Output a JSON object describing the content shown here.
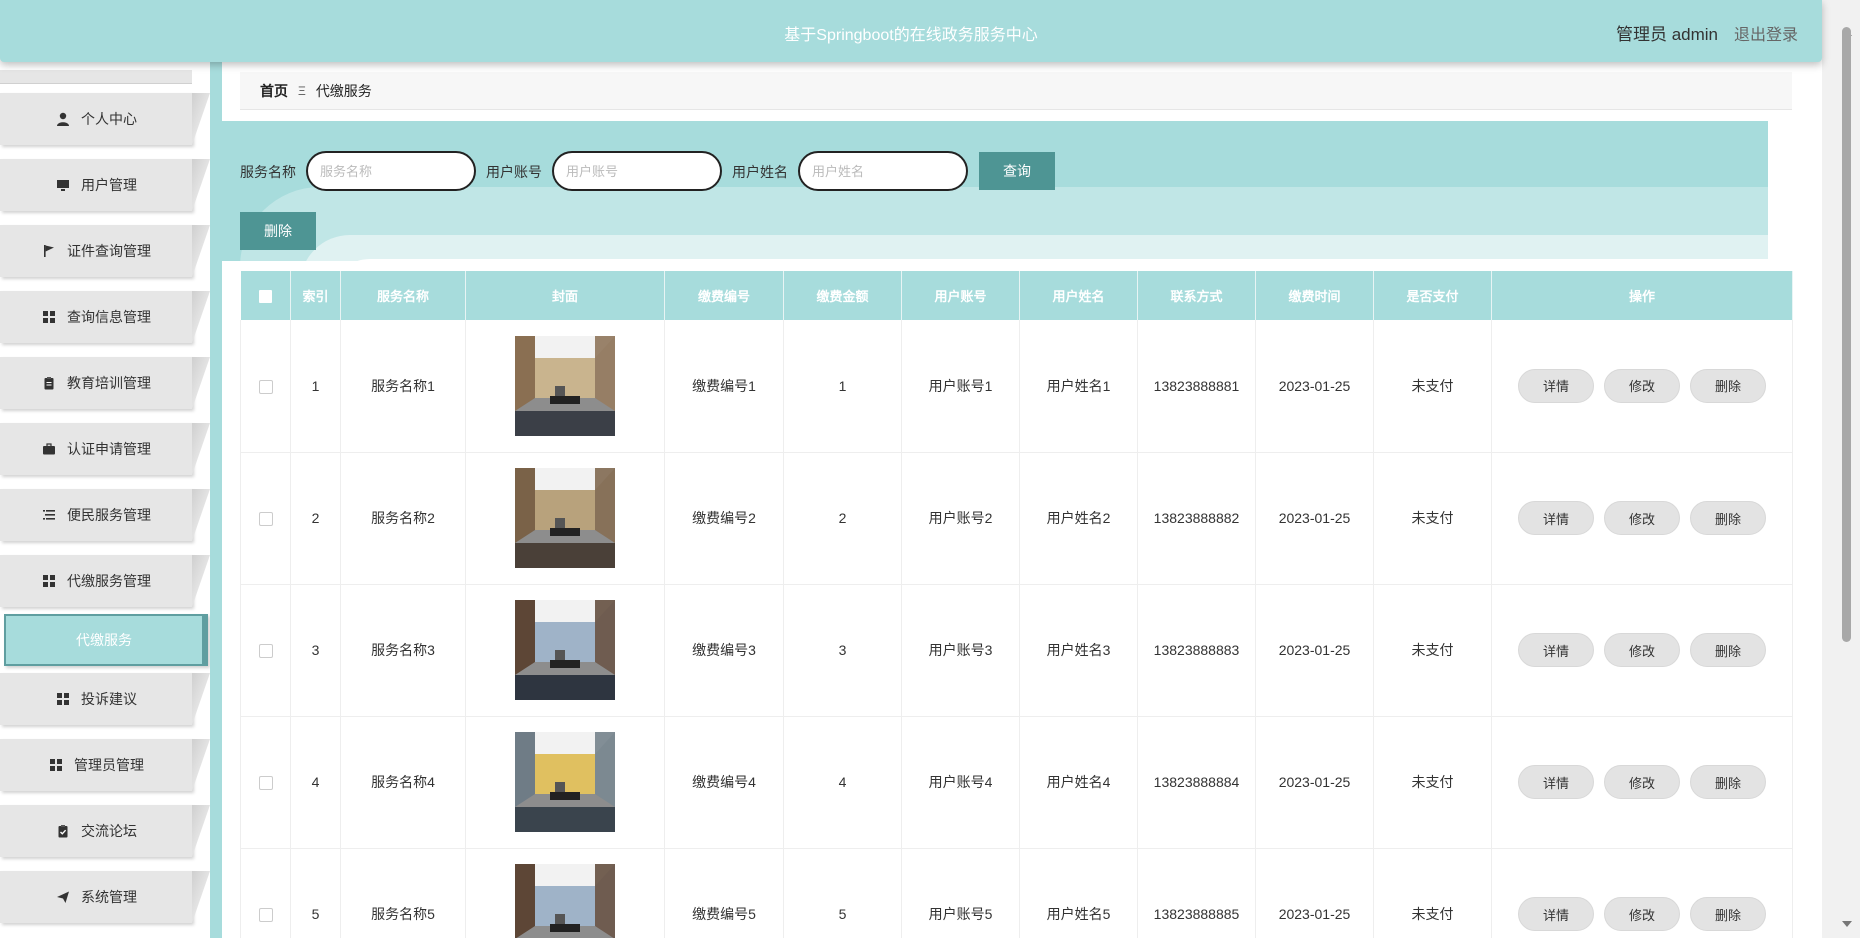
{
  "header": {
    "title": "基于Springboot的在线政务服务中心",
    "user_label": "管理员 admin",
    "logout_label": "退出登录"
  },
  "sidebar": {
    "items": [
      {
        "label": "个人中心",
        "icon": "user-icon"
      },
      {
        "label": "用户管理",
        "icon": "monitor-icon"
      },
      {
        "label": "证件查询管理",
        "icon": "flag-icon"
      },
      {
        "label": "查询信息管理",
        "icon": "grid-icon"
      },
      {
        "label": "教育培训管理",
        "icon": "clipboard-icon"
      },
      {
        "label": "认证申请管理",
        "icon": "briefcase-icon"
      },
      {
        "label": "便民服务管理",
        "icon": "list-icon"
      },
      {
        "label": "代缴服务管理",
        "icon": "grid-icon"
      },
      {
        "label": "代缴服务",
        "icon": "",
        "active": true
      },
      {
        "label": "投诉建议",
        "icon": "grid-icon"
      },
      {
        "label": "管理员管理",
        "icon": "grid-icon"
      },
      {
        "label": "交流论坛",
        "icon": "clipboard-check-icon"
      },
      {
        "label": "系统管理",
        "icon": "send-icon"
      }
    ]
  },
  "breadcrumb": {
    "home": "首页",
    "separator": "Ξ",
    "current": "代缴服务"
  },
  "search": {
    "service_name_label": "服务名称",
    "service_name_placeholder": "服务名称",
    "account_label": "用户账号",
    "account_placeholder": "用户账号",
    "username_label": "用户姓名",
    "username_placeholder": "用户姓名",
    "query_label": "查询",
    "delete_label": "删除"
  },
  "table": {
    "columns": [
      "索引",
      "服务名称",
      "封面",
      "缴费编号",
      "缴费金额",
      "用户账号",
      "用户姓名",
      "联系方式",
      "缴费时间",
      "是否支付",
      "操作"
    ],
    "action_labels": {
      "detail": "详情",
      "edit": "修改",
      "delete": "删除"
    },
    "rows": [
      {
        "index": "1",
        "service_name": "服务名称1",
        "cover": "office-photo-1",
        "pay_no": "缴费编号1",
        "amount": "1",
        "account": "用户账号1",
        "username": "用户姓名1",
        "phone": "13823888881",
        "pay_time": "2023-01-25",
        "paid": "未支付"
      },
      {
        "index": "2",
        "service_name": "服务名称2",
        "cover": "office-photo-2",
        "pay_no": "缴费编号2",
        "amount": "2",
        "account": "用户账号2",
        "username": "用户姓名2",
        "phone": "13823888882",
        "pay_time": "2023-01-25",
        "paid": "未支付"
      },
      {
        "index": "3",
        "service_name": "服务名称3",
        "cover": "office-photo-3",
        "pay_no": "缴费编号3",
        "amount": "3",
        "account": "用户账号3",
        "username": "用户姓名3",
        "phone": "13823888883",
        "pay_time": "2023-01-25",
        "paid": "未支付"
      },
      {
        "index": "4",
        "service_name": "服务名称4",
        "cover": "office-photo-4",
        "pay_no": "缴费编号4",
        "amount": "4",
        "account": "用户账号4",
        "username": "用户姓名4",
        "phone": "13823888884",
        "pay_time": "2023-01-25",
        "paid": "未支付"
      },
      {
        "index": "5",
        "service_name": "服务名称5",
        "cover": "office-photo-3",
        "pay_no": "缴费编号5",
        "amount": "5",
        "account": "用户账号5",
        "username": "用户姓名5",
        "phone": "13823888885",
        "pay_time": "2023-01-25",
        "paid": "未支付"
      }
    ]
  },
  "colors": {
    "accent": "#a7dcdc",
    "button": "#4e9594"
  }
}
